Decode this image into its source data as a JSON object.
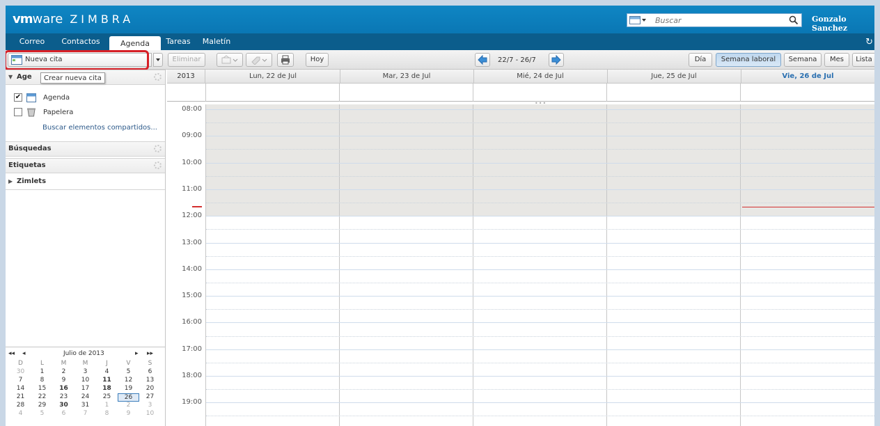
{
  "header": {
    "logo_vm": "vm",
    "logo_ware": "ware",
    "logo_product": "ZIMBRA",
    "search_placeholder": "Buscar",
    "user_name": "Gonzalo Sanchez"
  },
  "tabs": [
    {
      "label": "Correo"
    },
    {
      "label": "Contactos"
    },
    {
      "label": "Agenda",
      "active": true
    },
    {
      "label": "Tareas"
    },
    {
      "label": "Maletín"
    }
  ],
  "toolbar": {
    "new_appointment": "Nueva cita",
    "new_tooltip": "Crear nueva cita",
    "delete": "Eliminar",
    "today": "Hoy",
    "date_range": "22/7 - 26/7",
    "views": [
      {
        "label": "Día"
      },
      {
        "label": "Semana laboral",
        "active": true
      },
      {
        "label": "Semana"
      },
      {
        "label": "Mes"
      },
      {
        "label": "Lista"
      }
    ]
  },
  "sidebar": {
    "agenda_header": "Age",
    "folders": [
      {
        "label": "Agenda",
        "checked": true,
        "icon": "calendar-icon"
      },
      {
        "label": "Papelera",
        "checked": false,
        "icon": "trash-icon"
      }
    ],
    "find_shared": "Buscar elementos compartidos...",
    "searches": "Búsquedas",
    "tags": "Etiquetas",
    "zimlets": "Zimlets"
  },
  "minical": {
    "month": "Julio de 2013",
    "dow": [
      "D",
      "L",
      "M",
      "M",
      "J",
      "V",
      "S"
    ],
    "weeks": [
      [
        "30",
        "1",
        "2",
        "3",
        "4",
        "5",
        "6"
      ],
      [
        "7",
        "8",
        "9",
        "10",
        "11",
        "12",
        "13"
      ],
      [
        "14",
        "15",
        "16",
        "17",
        "18",
        "19",
        "20"
      ],
      [
        "21",
        "22",
        "23",
        "24",
        "25",
        "26",
        "27"
      ],
      [
        "28",
        "29",
        "30",
        "31",
        "1",
        "2",
        "3"
      ],
      [
        "4",
        "5",
        "6",
        "7",
        "8",
        "9",
        "10"
      ]
    ],
    "today": "26"
  },
  "calendar": {
    "year": "2013",
    "days": [
      {
        "label": "Lun, 22 de Jul"
      },
      {
        "label": "Mar, 23 de Jul"
      },
      {
        "label": "Mié, 24 de Jul"
      },
      {
        "label": "Jue, 25 de Jul"
      },
      {
        "label": "Vie, 26 de Jul",
        "today": true
      }
    ],
    "hours": [
      "08:00",
      "09:00",
      "10:00",
      "11:00",
      "12:00",
      "13:00",
      "14:00",
      "15:00",
      "16:00",
      "17:00",
      "18:00",
      "19:00"
    ]
  },
  "colors": {
    "header_blue": "#0f86c4",
    "tab_bar": "#0b5d8c",
    "highlight_red": "#d61f26",
    "current_time": "#d32f2f"
  }
}
